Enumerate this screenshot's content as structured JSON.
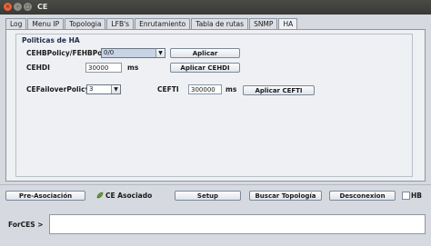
{
  "window": {
    "title": "CE",
    "close_glyph": "×",
    "min_glyph": "–",
    "max_glyph": "□"
  },
  "tabs": [
    {
      "label": "Log"
    },
    {
      "label": "Menu IP"
    },
    {
      "label": "Topologia"
    },
    {
      "label": "LFB's"
    },
    {
      "label": "Enrutamiento"
    },
    {
      "label": "Tabla de rutas"
    },
    {
      "label": "SNMP"
    },
    {
      "label": "HA",
      "active": true
    }
  ],
  "ha": {
    "group_title": "Politicas de HA",
    "cehb_label": "CEHBPolicy/FEHBPolicy",
    "cehb_value": "0/0",
    "aplicar_label": "Aplicar",
    "cehdi_label": "CEHDI",
    "cehdi_value": "30000",
    "cehdi_unit": "ms",
    "aplicar_cehdi_label": "Aplicar CEHDI",
    "failover_label": "CEFailoverPolicy",
    "failover_value": "3",
    "cefti_label": "CEFTI",
    "cefti_value": "300000",
    "cefti_unit": "ms",
    "aplicar_cefti_label": "Aplicar CEFTI"
  },
  "bottom": {
    "pre_asociacion_label": "Pre-Asociación",
    "status_text": "CE Asociado",
    "setup_label": "Setup",
    "buscar_label": "Buscar Topología",
    "desconexion_label": "Desconexion",
    "hb_label": "HB",
    "hb_checked": false
  },
  "console": {
    "prompt": "ForCES >",
    "value": ""
  }
}
